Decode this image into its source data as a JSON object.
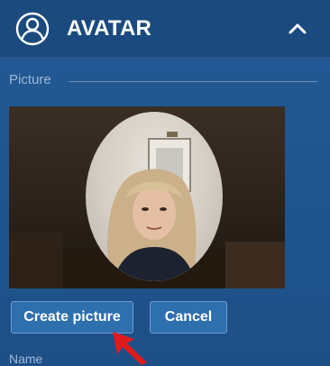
{
  "header": {
    "title": "AVATAR",
    "icon": "user-circle-icon",
    "collapse_icon": "chevron-up-icon"
  },
  "picture_section": {
    "label": "Picture"
  },
  "buttons": {
    "create_label": "Create picture",
    "cancel_label": "Cancel"
  },
  "next_section": {
    "label": "Name"
  },
  "colors": {
    "panel": "#1f5690",
    "header": "#1b4a7e",
    "button": "#2e6fae",
    "label": "#9fb7d5",
    "cursor": "#e11b1b"
  }
}
